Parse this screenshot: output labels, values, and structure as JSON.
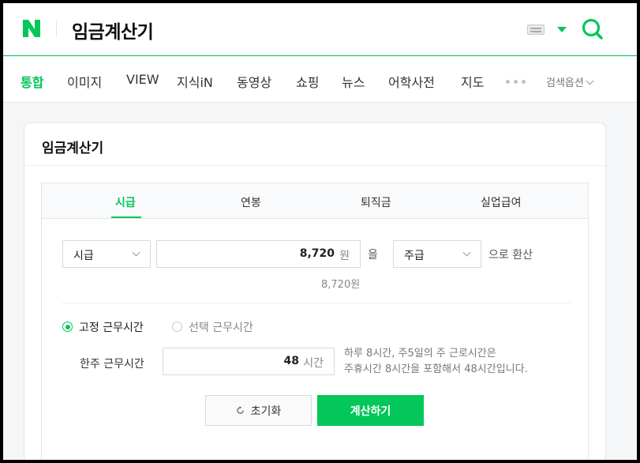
{
  "header": {
    "logo": "N",
    "query": "임금계산기",
    "icons": [
      "keyboard-icon",
      "dropdown-caret-icon",
      "search-icon"
    ],
    "accent_color": "#03c75a"
  },
  "nav": {
    "tabs": [
      {
        "label": "통합",
        "active": true
      },
      {
        "label": "이미지",
        "active": false
      },
      {
        "label": "VIEW",
        "active": false
      },
      {
        "label": "지식iN",
        "active": false
      },
      {
        "label": "동영상",
        "active": false
      },
      {
        "label": "쇼핑",
        "active": false
      },
      {
        "label": "뉴스",
        "active": false
      },
      {
        "label": "어학사전",
        "active": false
      },
      {
        "label": "지도",
        "active": false
      }
    ],
    "search_options": "검색옵션"
  },
  "calculator": {
    "title": "임금계산기",
    "tabs": [
      {
        "label": "시급",
        "active": true
      },
      {
        "label": "연봉",
        "active": false
      },
      {
        "label": "퇴직금",
        "active": false
      },
      {
        "label": "실업급여",
        "active": false
      }
    ],
    "from_unit": "시급",
    "amount_value": "8,720",
    "amount_unit": "원",
    "particle": "을",
    "to_unit": "주급",
    "convert_suffix": "으로 환산",
    "amount_hint": "8,720원",
    "work_type": {
      "fixed_label": "고정 근무시간",
      "fixed_selected": true,
      "selective_label": "선택 근무시간",
      "selective_selected": false
    },
    "weekly_hours_label": "한주 근무시간",
    "weekly_hours_value": "48",
    "weekly_hours_unit": "시간",
    "description_line1": "하루 8시간, 주5일의 주 근로시간은",
    "description_line2": "주휴시간 8시간을 포함해서 48시간입니다.",
    "reset_label": "초기화",
    "calculate_label": "계산하기"
  }
}
